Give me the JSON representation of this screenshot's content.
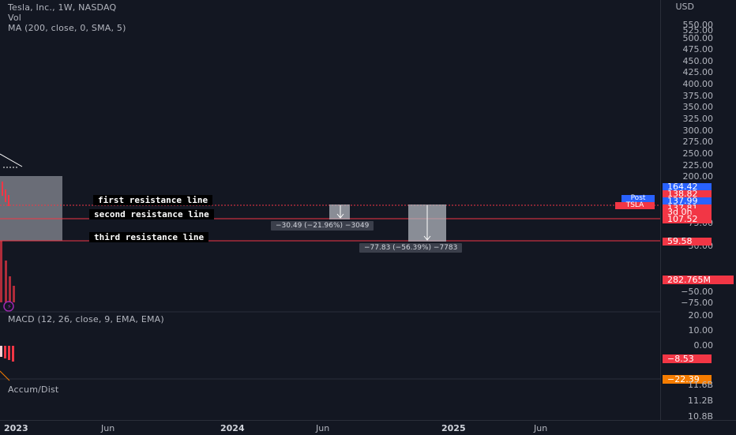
{
  "legend": {
    "symbol_line": "Tesla, Inc., 1W, NASDAQ",
    "vol_line": "Vol",
    "ma_line": "MA (200, close, 0, SMA, 5)",
    "macd_line": "MACD (12, 26, close, 9, EMA, EMA)",
    "accum_line": "Accum/Dist"
  },
  "annotations": {
    "first": "first resistance line",
    "second": "second resistance line",
    "third": "third resistance line",
    "measure_1": "−30.49 (−21.96%) −3049",
    "measure_2": "−77.83 (−56.39%) −7783"
  },
  "price_axis": {
    "unit": "USD",
    "labels": [
      "550.00",
      "525.00",
      "500.00",
      "475.00",
      "450.00",
      "425.00",
      "400.00",
      "375.00",
      "350.00",
      "325.00",
      "300.00",
      "275.00",
      "250.00",
      "225.00",
      "200.00",
      "75.00",
      "50.00",
      "−50.00",
      "−75.00"
    ]
  },
  "price_tags": {
    "high": "164.42",
    "r1": "138.82",
    "post_value": "137.99",
    "last_value": "137.81",
    "countdown": "3d 0h",
    "r2": "107.52",
    "r3": "59.58",
    "volume": "282.765M",
    "post_label": "Post",
    "ticker_label": "TSLA"
  },
  "macd_axis": {
    "labels": [
      "20.00",
      "10.00",
      "0.00"
    ],
    "tag1": "−8.53",
    "tag2": "−22.39"
  },
  "accum_axis": {
    "labels": [
      "11.6B",
      "11.2B",
      "10.8B"
    ],
    "hidden_label": "20.00"
  },
  "time_axis": {
    "labels": [
      {
        "text": "2023",
        "year": true
      },
      {
        "text": "Jun",
        "year": false
      },
      {
        "text": "2024",
        "year": true
      },
      {
        "text": "Jun",
        "year": false
      },
      {
        "text": "2025",
        "year": true
      },
      {
        "text": "Jun",
        "year": false
      }
    ]
  },
  "colors": {
    "background": "#131722",
    "resistance": "#f23645",
    "blue_tag": "#2962ff",
    "red_tag": "#f23645",
    "orange_tag": "#f57c00",
    "measure_fill": "#b2b5be"
  }
}
